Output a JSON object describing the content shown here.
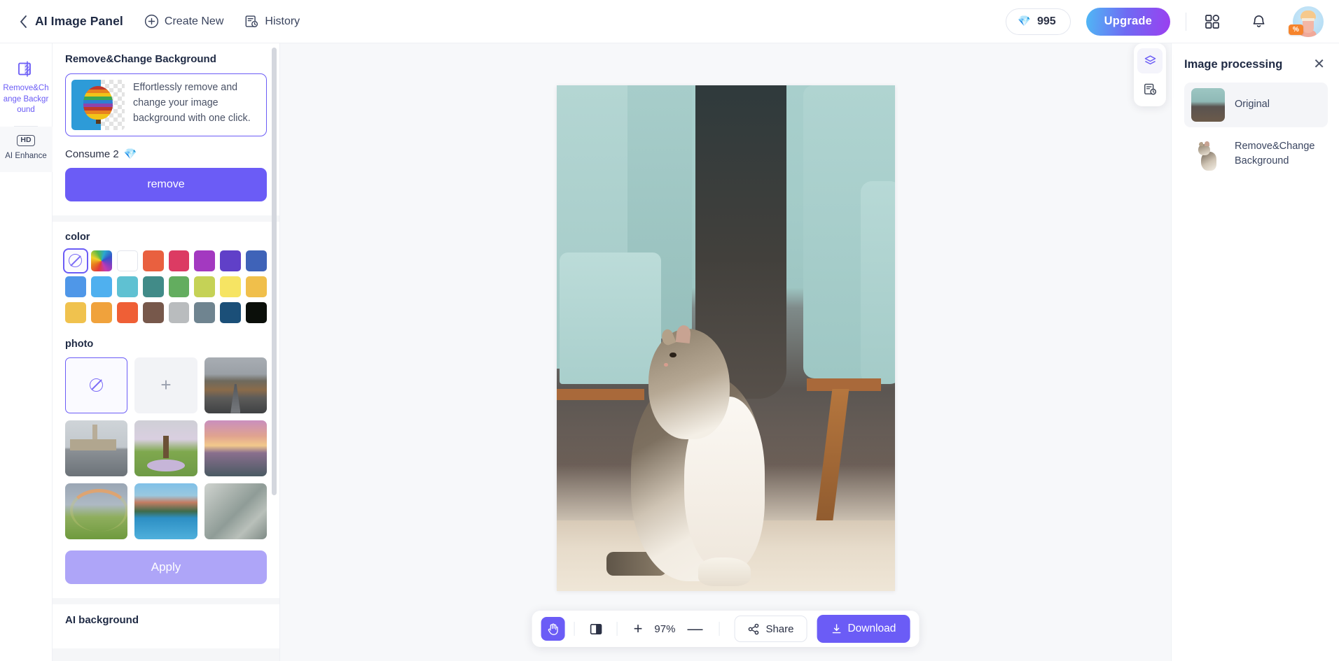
{
  "header": {
    "back_icon": "chevron-left-icon",
    "title": "AI Image Panel",
    "create_new": "Create New",
    "create_new_icon": "plus-circle-icon",
    "history": "History",
    "history_icon": "history-document-icon",
    "credits": "995",
    "credits_icon": "gem-icon",
    "upgrade": "Upgrade",
    "apps_icon": "grid-apps-icon",
    "bell_icon": "bell-icon",
    "avatar_icon": "user-avatar",
    "avatar_badge": "%"
  },
  "rail": {
    "items": [
      {
        "label": "Remove&Change Background",
        "icon": "remove-background-icon",
        "active": true
      },
      {
        "label": "AI Enhance",
        "icon": "hd-icon",
        "active": false
      }
    ]
  },
  "panel": {
    "card_title": "Remove&Change Background",
    "promo_text": "Effortlessly remove and change your image background with one click.",
    "promo_image": "hot-air-balloon-thumbnail",
    "consume_label": "Consume 2",
    "consume_icon": "gem-icon",
    "remove_button": "remove",
    "color_label": "color",
    "photo_label": "photo",
    "apply_button": "Apply",
    "next_section_title": "AI background",
    "colors": [
      "none",
      "rainbow",
      "#ffffff",
      "#e9603f",
      "#dc3b63",
      "#a339c0",
      "#6040c8",
      "#3f63b8",
      "#4f97e8",
      "#4fb0ef",
      "#5fc1d2",
      "#418b88",
      "#63ad5f",
      "#c5d256",
      "#f6e463",
      "#f0bf4b",
      "#f0c24e",
      "#f0a23c",
      "#ef5f36",
      "#77584b",
      "#b9bcbe",
      "#6f8490",
      "#1b4f78",
      "#0b0f0a"
    ],
    "photos": [
      {
        "name": "none",
        "selected": true
      },
      {
        "name": "upload-add"
      },
      {
        "name": "mountain-road"
      },
      {
        "name": "big-ben-london"
      },
      {
        "name": "cherry-blossom-tree"
      },
      {
        "name": "sunset-lake"
      },
      {
        "name": "rainbow-field"
      },
      {
        "name": "mountain-lake-reflection"
      },
      {
        "name": "abstract-grey"
      }
    ]
  },
  "canvas": {
    "image_name": "tabby-cat-sitting-on-floor",
    "toolbar": {
      "hand_icon": "hand-pan-icon",
      "compare_icon": "before-after-compare-icon",
      "zoom_in": "+",
      "zoom_level": "97%",
      "zoom_out": "—",
      "share_label": "Share",
      "share_icon": "share-nodes-icon",
      "download_label": "Download",
      "download_icon": "download-arrow-icon"
    }
  },
  "right_panel": {
    "title": "Image processing",
    "close_icon": "close-x-icon",
    "rail": [
      {
        "icon": "layers-icon",
        "active": true
      },
      {
        "icon": "history-clock-icon",
        "active": false
      }
    ],
    "layers": [
      {
        "label": "Original",
        "thumb": "cat-original-thumbnail",
        "active": true
      },
      {
        "label": "Remove&Change Background",
        "thumb": "cat-cutout-thumbnail",
        "active": false
      }
    ]
  }
}
